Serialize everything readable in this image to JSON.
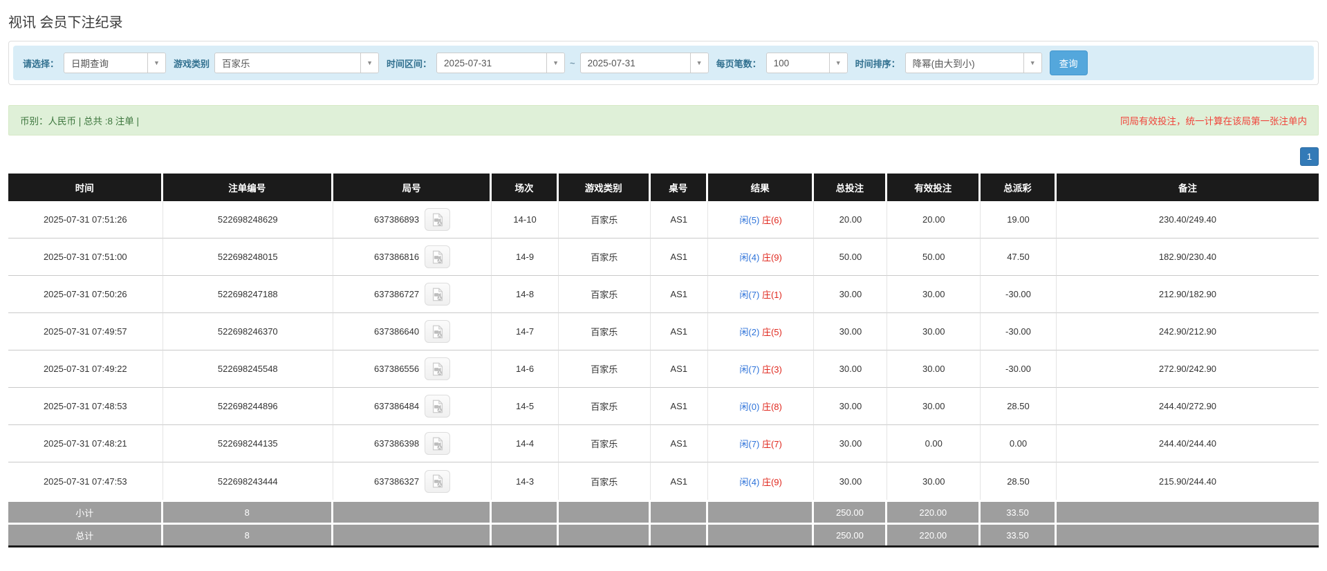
{
  "page": {
    "title": "视讯 会员下注纪录"
  },
  "filters": {
    "query_type": {
      "label": "请选择：",
      "value": "日期查询"
    },
    "game_type": {
      "label": "游戏类别",
      "value": "百家乐"
    },
    "time_range": {
      "label": "时间区间：",
      "from": "2025-07-31",
      "separator": "~",
      "to": "2025-07-31"
    },
    "page_size": {
      "label": "每页笔数：",
      "value": "100"
    },
    "time_sort": {
      "label": "时间排序：",
      "value": "降幂(由大到小)"
    },
    "search_button_label": "查询"
  },
  "info_bar": {
    "summary_text": "币别：人民币 | 总共 :8 注单 |",
    "notice_text": "同局有效投注，统一计算在该局第一张注单内"
  },
  "pagination": {
    "current_page": "1"
  },
  "table": {
    "headers": [
      "时间",
      "注单编号",
      "局号",
      "场次",
      "游戏类别",
      "桌号",
      "结果",
      "总投注",
      "有效投注",
      "总派彩",
      "备注"
    ],
    "rows": [
      {
        "time": "2025-07-31 07:51:26",
        "bet_id": "522698248629",
        "round_id": "637386893",
        "session": "14-10",
        "game": "百家乐",
        "table_no": "AS1",
        "result_player": "闲(5)",
        "result_banker": "庄(6)",
        "total_bet": "20.00",
        "valid_bet": "20.00",
        "payout": "19.00",
        "remark": "230.40/249.40"
      },
      {
        "time": "2025-07-31 07:51:00",
        "bet_id": "522698248015",
        "round_id": "637386816",
        "session": "14-9",
        "game": "百家乐",
        "table_no": "AS1",
        "result_player": "闲(4)",
        "result_banker": "庄(9)",
        "total_bet": "50.00",
        "valid_bet": "50.00",
        "payout": "47.50",
        "remark": "182.90/230.40"
      },
      {
        "time": "2025-07-31 07:50:26",
        "bet_id": "522698247188",
        "round_id": "637386727",
        "session": "14-8",
        "game": "百家乐",
        "table_no": "AS1",
        "result_player": "闲(7)",
        "result_banker": "庄(1)",
        "total_bet": "30.00",
        "valid_bet": "30.00",
        "payout": "-30.00",
        "remark": "212.90/182.90"
      },
      {
        "time": "2025-07-31 07:49:57",
        "bet_id": "522698246370",
        "round_id": "637386640",
        "session": "14-7",
        "game": "百家乐",
        "table_no": "AS1",
        "result_player": "闲(2)",
        "result_banker": "庄(5)",
        "total_bet": "30.00",
        "valid_bet": "30.00",
        "payout": "-30.00",
        "remark": "242.90/212.90"
      },
      {
        "time": "2025-07-31 07:49:22",
        "bet_id": "522698245548",
        "round_id": "637386556",
        "session": "14-6",
        "game": "百家乐",
        "table_no": "AS1",
        "result_player": "闲(7)",
        "result_banker": "庄(3)",
        "total_bet": "30.00",
        "valid_bet": "30.00",
        "payout": "-30.00",
        "remark": "272.90/242.90"
      },
      {
        "time": "2025-07-31 07:48:53",
        "bet_id": "522698244896",
        "round_id": "637386484",
        "session": "14-5",
        "game": "百家乐",
        "table_no": "AS1",
        "result_player": "闲(0)",
        "result_banker": "庄(8)",
        "total_bet": "30.00",
        "valid_bet": "30.00",
        "payout": "28.50",
        "remark": "244.40/272.90"
      },
      {
        "time": "2025-07-31 07:48:21",
        "bet_id": "522698244135",
        "round_id": "637386398",
        "session": "14-4",
        "game": "百家乐",
        "table_no": "AS1",
        "result_player": "闲(7)",
        "result_banker": "庄(7)",
        "total_bet": "30.00",
        "valid_bet": "0.00",
        "payout": "0.00",
        "remark": "244.40/244.40"
      },
      {
        "time": "2025-07-31 07:47:53",
        "bet_id": "522698243444",
        "round_id": "637386327",
        "session": "14-3",
        "game": "百家乐",
        "table_no": "AS1",
        "result_player": "闲(4)",
        "result_banker": "庄(9)",
        "total_bet": "30.00",
        "valid_bet": "30.00",
        "payout": "28.50",
        "remark": "215.90/244.40"
      }
    ],
    "subtotal": {
      "label": "小计",
      "count": "8",
      "total_bet": "250.00",
      "valid_bet": "220.00",
      "payout": "33.50"
    },
    "total": {
      "label": "总计",
      "count": "8",
      "total_bet": "250.00",
      "valid_bet": "220.00",
      "payout": "33.50"
    }
  },
  "icons": {
    "dropdown_arrow": "▼",
    "video_replay": "video-replay-icon"
  },
  "colors": {
    "header_bg": "#1b1b1b",
    "summary_bg": "#9e9e9e",
    "filter_bar_bg": "#d9edf7",
    "filter_label": "#31708f",
    "info_bar_bg": "#dff0d8",
    "info_text": "#3c763d",
    "notice_red": "#f0443b",
    "link_blue": "#2d72d9",
    "banker_red": "#e0281e",
    "button_bg": "#54a7dc",
    "button_border": "#4396cd",
    "pager_bg": "#337ab7",
    "pager_border": "#2e6da4"
  }
}
